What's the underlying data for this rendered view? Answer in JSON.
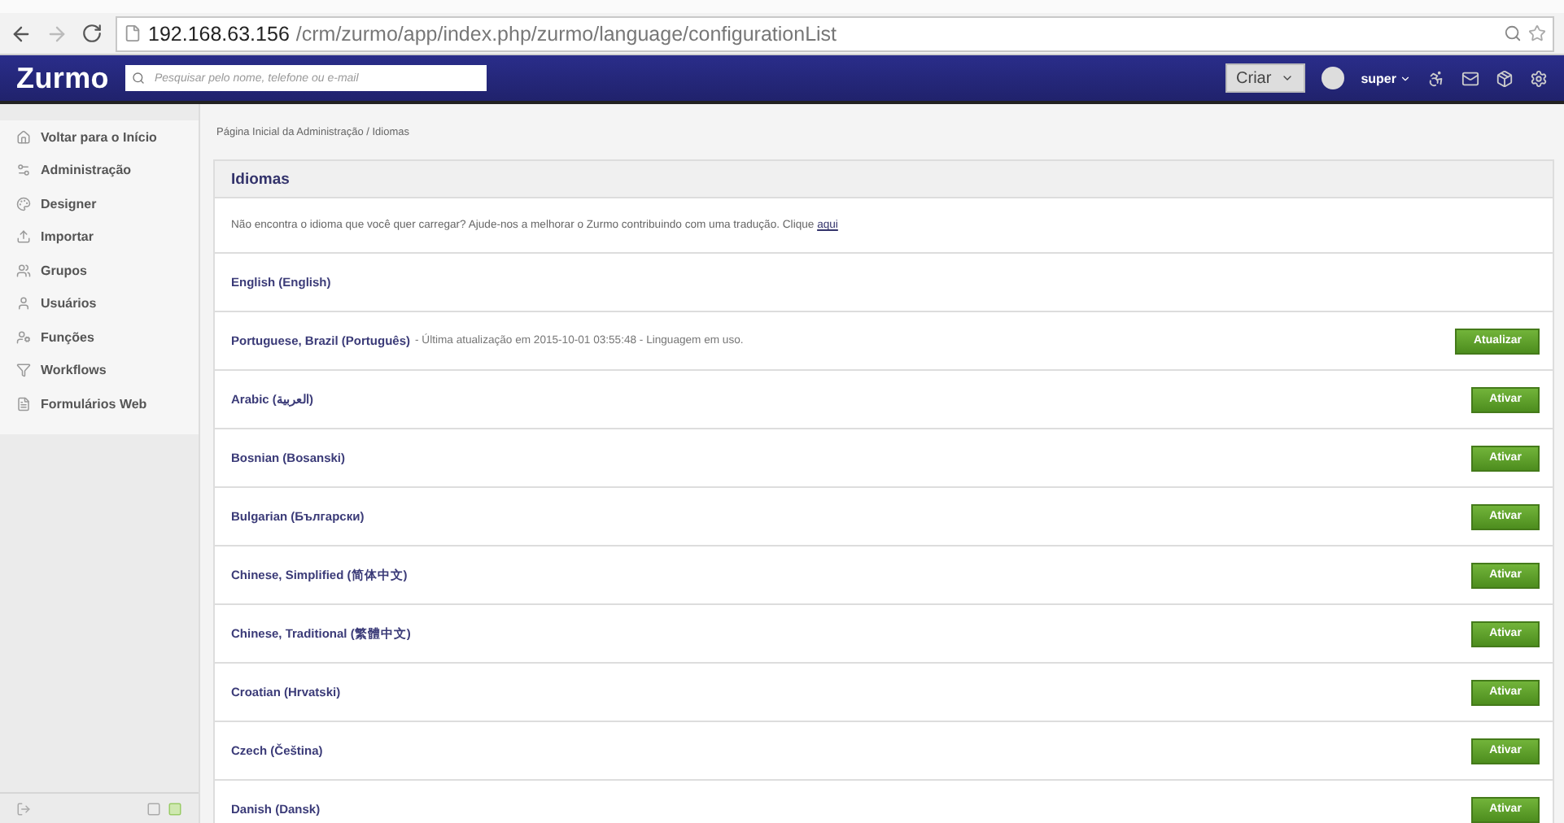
{
  "browser": {
    "url_host": "192.168.63.156",
    "url_path": "/crm/zurmo/app/index.php/zurmo/language/configurationList"
  },
  "navbar": {
    "logo": "Zurmo",
    "search": {
      "placeholder": "Pesquisar pelo nome, telefone ou e-mail"
    },
    "create_button": "Criar",
    "user": "super"
  },
  "sidebar": {
    "items": [
      {
        "label": "Voltar para o Início"
      },
      {
        "label": "Administração"
      },
      {
        "label": "Designer"
      },
      {
        "label": "Importar"
      },
      {
        "label": "Grupos"
      },
      {
        "label": "Usuários"
      },
      {
        "label": "Funções"
      },
      {
        "label": "Workflows"
      },
      {
        "label": "Formulários Web"
      }
    ]
  },
  "breadcrumb": "Página Inicial da Administração / Idiomas",
  "panel": {
    "title": "Idiomas",
    "intro": "Não encontra o idioma que você quer carregar? Ajude-nos a melhorar o Zurmo contribuindo com uma tradução. Clique",
    "intro_link": "aqui",
    "languages": [
      {
        "name": "English (English)"
      },
      {
        "name": "Portuguese, Brazil (Português)",
        "note": "- Última atualização em 2015-10-01 03:55:48 - Linguagem em uso.",
        "button": "Atualizar"
      },
      {
        "name": "Arabic (العربية)",
        "button": "Ativar"
      },
      {
        "name": "Bosnian (Bosanski)",
        "button": "Ativar"
      },
      {
        "name": "Bulgarian (Български)",
        "button": "Ativar"
      },
      {
        "name": "Chinese, Simplified (简体中文)",
        "button": "Ativar"
      },
      {
        "name": "Chinese, Traditional (繁體中文)",
        "button": "Ativar"
      },
      {
        "name": "Croatian (Hrvatski)",
        "button": "Ativar"
      },
      {
        "name": "Czech (Čeština)",
        "button": "Ativar"
      },
      {
        "name": "Danish (Dansk)",
        "button": "Ativar"
      }
    ]
  }
}
